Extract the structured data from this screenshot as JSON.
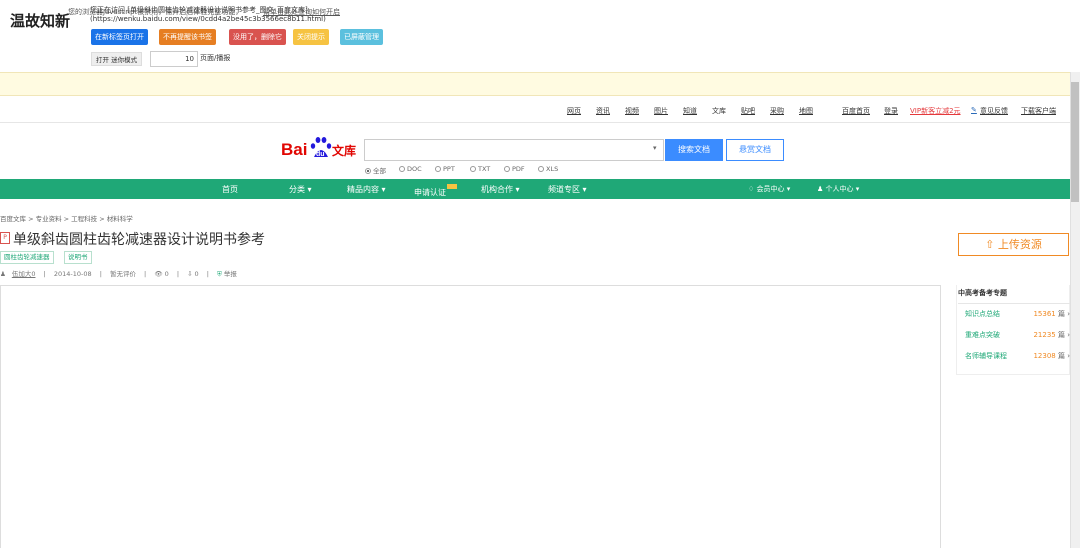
{
  "brand": "温故知新",
  "visit": {
    "line1": "您正在访问 [单级斜齿圆柱齿轮减速器设计说明书参考_图文_百度文库]",
    "line2": "(https://wenku.baidu.com/view/0cdd4a2be45c3b3566ec8b11.html)"
  },
  "toolbar": {
    "buttons": [
      {
        "label": "在新标签页打开",
        "color": "#1a73e8"
      },
      {
        "label": "不再提醒该书签",
        "color": "#e67e22"
      },
      {
        "label": "没用了，删除它",
        "color": "#d9534f"
      },
      {
        "label": "关闭提示",
        "color": "#f6c342"
      },
      {
        "label": "已屏蔽管理",
        "color": "#5bc0de"
      }
    ],
    "open_mode": "打开 迷你模式",
    "pages_value": "10",
    "pages_unit": "页面/播报"
  },
  "js_notice": {
    "message": "您的浏览器Javascript被禁用，需开启后体验完整功能，",
    "link": "请单击此处查询如何开启"
  },
  "top_links": [
    "网页",
    "资讯",
    "视频",
    "图片",
    "知道",
    "文库",
    "贴吧",
    "采购",
    "地图",
    "百度首页",
    "登录",
    "VIP新客立减2元",
    "意见反馈",
    "下载客户端"
  ],
  "search": {
    "logo_bai": "Bai",
    "logo_du": "du",
    "logo_wenku": "文库",
    "search_label": "搜索文档",
    "reward_label": "悬赏文档",
    "filters": [
      "全部",
      "DOC",
      "PPT",
      "TXT",
      "PDF",
      "XLS"
    ]
  },
  "nav": {
    "items": [
      "首页",
      "分类",
      "精品内容",
      "申请认证",
      "机构合作",
      "频道专区"
    ],
    "right": [
      "会员中心",
      "个人中心"
    ]
  },
  "breadcrumb": "百度文库 > 专业资料 > 工程科技 > 材料科学",
  "doc": {
    "type_icon": "P",
    "title": "单级斜齿圆柱齿轮减速器设计说明书参考",
    "tags": [
      "圆柱齿轮减速器",
      "说明书"
    ],
    "author": "伍加大0",
    "date": "2014-10-08",
    "rating": "暂无评价",
    "views": "0",
    "downloads": "0",
    "report": "举报"
  },
  "side": {
    "upload_label": "上传资源",
    "exam_title": "中高考备考专题",
    "exam_items": [
      {
        "name": "知识点总结",
        "count": "15361",
        "unit": "篇"
      },
      {
        "name": "重难点突破",
        "count": "21235",
        "unit": "篇"
      },
      {
        "name": "名师辅导课程",
        "count": "12308",
        "unit": "篇"
      }
    ]
  }
}
